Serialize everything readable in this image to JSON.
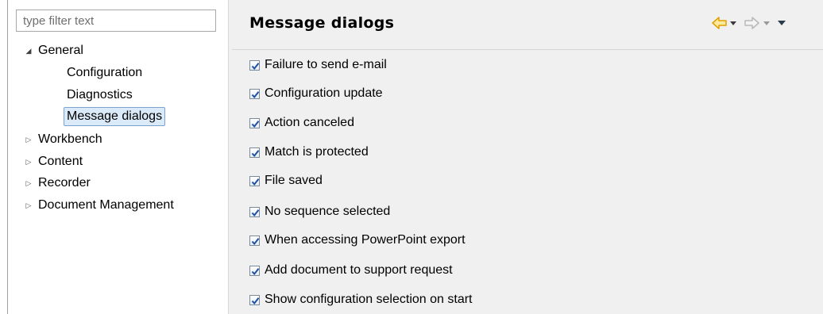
{
  "filter": {
    "placeholder": "type filter text",
    "value": ""
  },
  "tree": {
    "items": [
      {
        "label": "General",
        "expanded": true
      },
      {
        "label": "Configuration"
      },
      {
        "label": "Diagnostics"
      },
      {
        "label": "Message dialogs",
        "selected": true
      },
      {
        "label": "Workbench",
        "expanded": false
      },
      {
        "label": "Content",
        "expanded": false
      },
      {
        "label": "Recorder",
        "expanded": false
      },
      {
        "label": "Document Management",
        "expanded": false
      }
    ]
  },
  "page": {
    "title": "Message dialogs",
    "nav": {
      "back_icon": "back-arrow-icon",
      "forward_icon": "forward-arrow-icon",
      "menu_icon": "view-menu-icon"
    },
    "options": [
      {
        "label": "Failure to send e-mail",
        "checked": true
      },
      {
        "label": "Configuration update",
        "checked": true
      },
      {
        "label": "Action canceled",
        "checked": true
      },
      {
        "label": "Match is protected",
        "checked": true
      },
      {
        "label": "File saved",
        "checked": true
      },
      {
        "label": "No sequence selected",
        "checked": true
      },
      {
        "label": "When accessing PowerPoint export",
        "checked": true
      },
      {
        "label": "Add document to support request",
        "checked": true
      },
      {
        "label": "Show configuration selection on start",
        "checked": true
      }
    ]
  },
  "colors": {
    "accent_back_arrow": "#f0b400",
    "selection_bg": "#dbeaf9",
    "selection_border": "#7da2ce",
    "checkmark": "#1f4fa0"
  }
}
